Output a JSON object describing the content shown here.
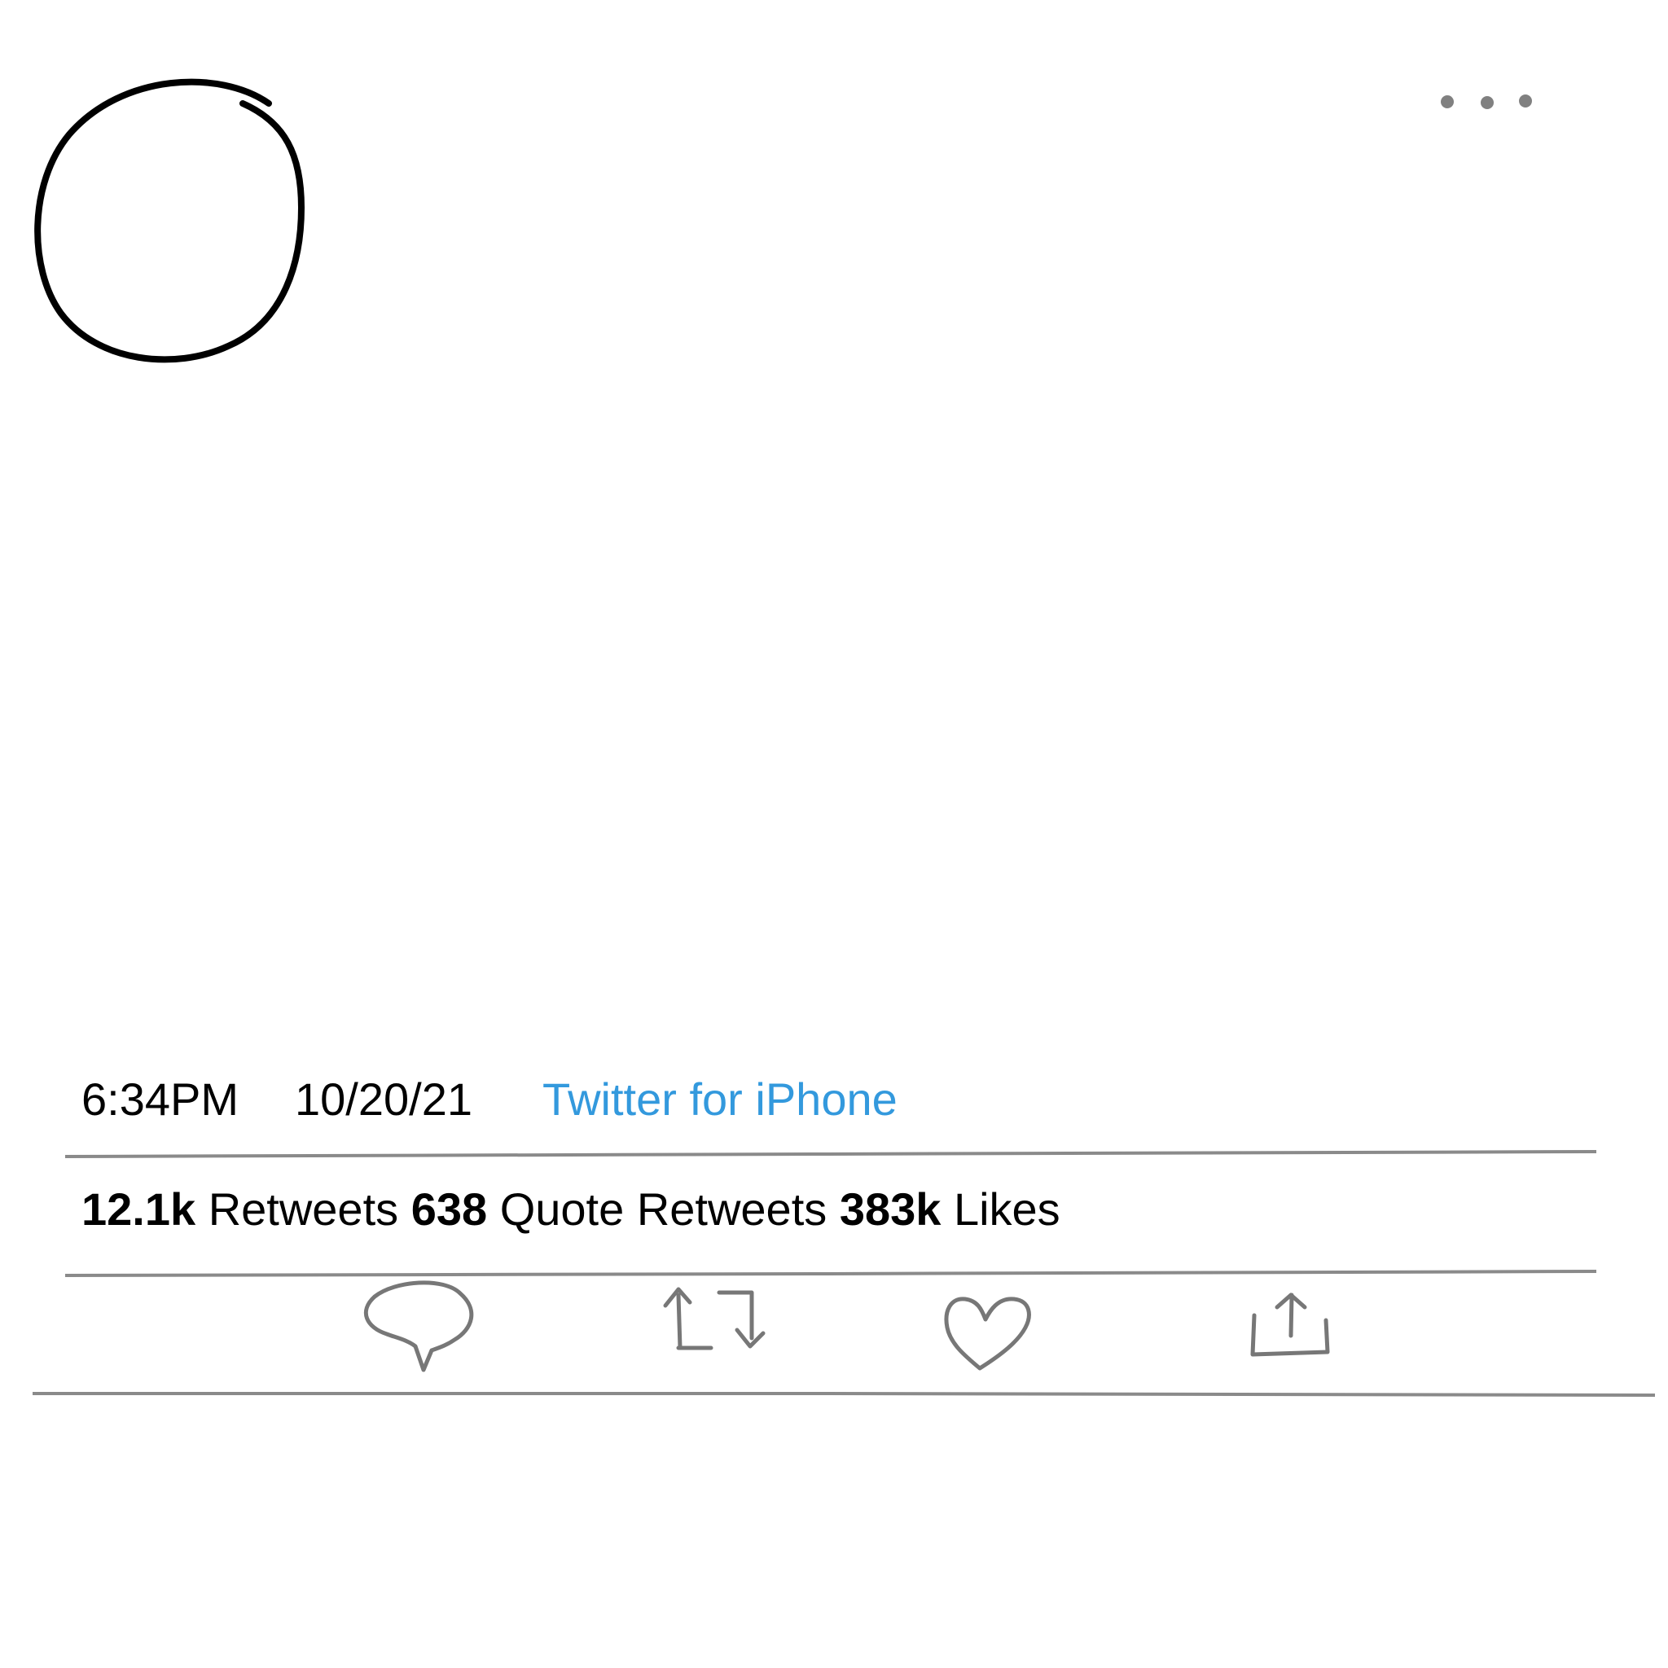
{
  "tweet": {
    "time": "6:34PM",
    "date": "10/20/21",
    "source": "Twitter for iPhone",
    "stats": {
      "retweets_count": "12.1k",
      "retweets_label": "Retweets",
      "quote_retweets_count": "638",
      "quote_retweets_label": "Quote Retweets",
      "likes_count": "383k",
      "likes_label": "Likes"
    }
  },
  "colors": {
    "text": "#000000",
    "source_link": "#3399dd",
    "icon_stroke": "#777777",
    "divider": "#8a8a8a",
    "background": "#ffffff"
  },
  "icons": {
    "avatar": "avatar-circle",
    "more": "more-horizontal-icon",
    "reply": "reply-icon",
    "retweet": "retweet-icon",
    "like": "heart-icon",
    "share": "share-icon"
  }
}
